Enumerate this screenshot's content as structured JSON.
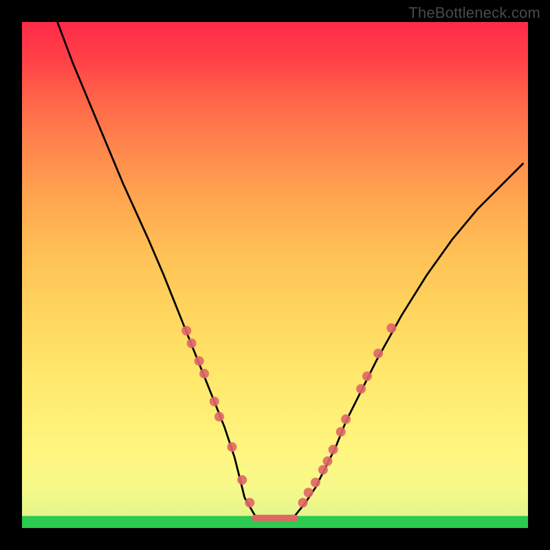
{
  "watermark": "TheBottleneck.com",
  "chart_data": {
    "type": "line",
    "title": "",
    "xlabel": "",
    "ylabel": "",
    "xlim": [
      0,
      100
    ],
    "ylim": [
      0,
      100
    ],
    "grid": false,
    "legend": false,
    "series": [
      {
        "name": "curve",
        "x": [
          7,
          10,
          15,
          20,
          25,
          28,
          30,
          32,
          34,
          36,
          38,
          40,
          42,
          43,
          44,
          46,
          48,
          52,
          54,
          56,
          58,
          60,
          62,
          64,
          67,
          70,
          75,
          80,
          85,
          90,
          95,
          99
        ],
        "values": [
          100,
          92,
          80,
          68,
          57,
          50,
          45,
          40,
          35,
          30,
          25,
          20,
          14,
          10,
          6,
          2.5,
          2,
          2,
          2.5,
          5,
          8,
          12,
          16,
          21,
          27,
          33,
          42,
          50,
          57,
          63,
          68,
          72
        ]
      }
    ],
    "annotations": {
      "floor_segment": {
        "x_start": 46,
        "x_end": 54,
        "y": 2
      },
      "dots_left": [
        {
          "x": 32.5,
          "y": 39
        },
        {
          "x": 33.5,
          "y": 36.5
        },
        {
          "x": 35.0,
          "y": 33
        },
        {
          "x": 36.0,
          "y": 30.5
        },
        {
          "x": 38.0,
          "y": 25
        },
        {
          "x": 39.0,
          "y": 22
        },
        {
          "x": 41.5,
          "y": 16
        },
        {
          "x": 43.5,
          "y": 9.5
        },
        {
          "x": 45.0,
          "y": 5
        }
      ],
      "dots_right": [
        {
          "x": 55.5,
          "y": 5
        },
        {
          "x": 56.6,
          "y": 7
        },
        {
          "x": 58.0,
          "y": 9
        },
        {
          "x": 59.5,
          "y": 11.5
        },
        {
          "x": 60.4,
          "y": 13.2
        },
        {
          "x": 61.5,
          "y": 15.5
        },
        {
          "x": 63.0,
          "y": 19
        },
        {
          "x": 64.0,
          "y": 21.5
        },
        {
          "x": 67.0,
          "y": 27.5
        },
        {
          "x": 68.2,
          "y": 30
        },
        {
          "x": 70.4,
          "y": 34.5
        },
        {
          "x": 73.0,
          "y": 39.5
        }
      ],
      "green_band_top": 2.5
    },
    "colors": {
      "curve": "#000000",
      "dots": "#e06666",
      "green": "#2cca4f"
    }
  }
}
